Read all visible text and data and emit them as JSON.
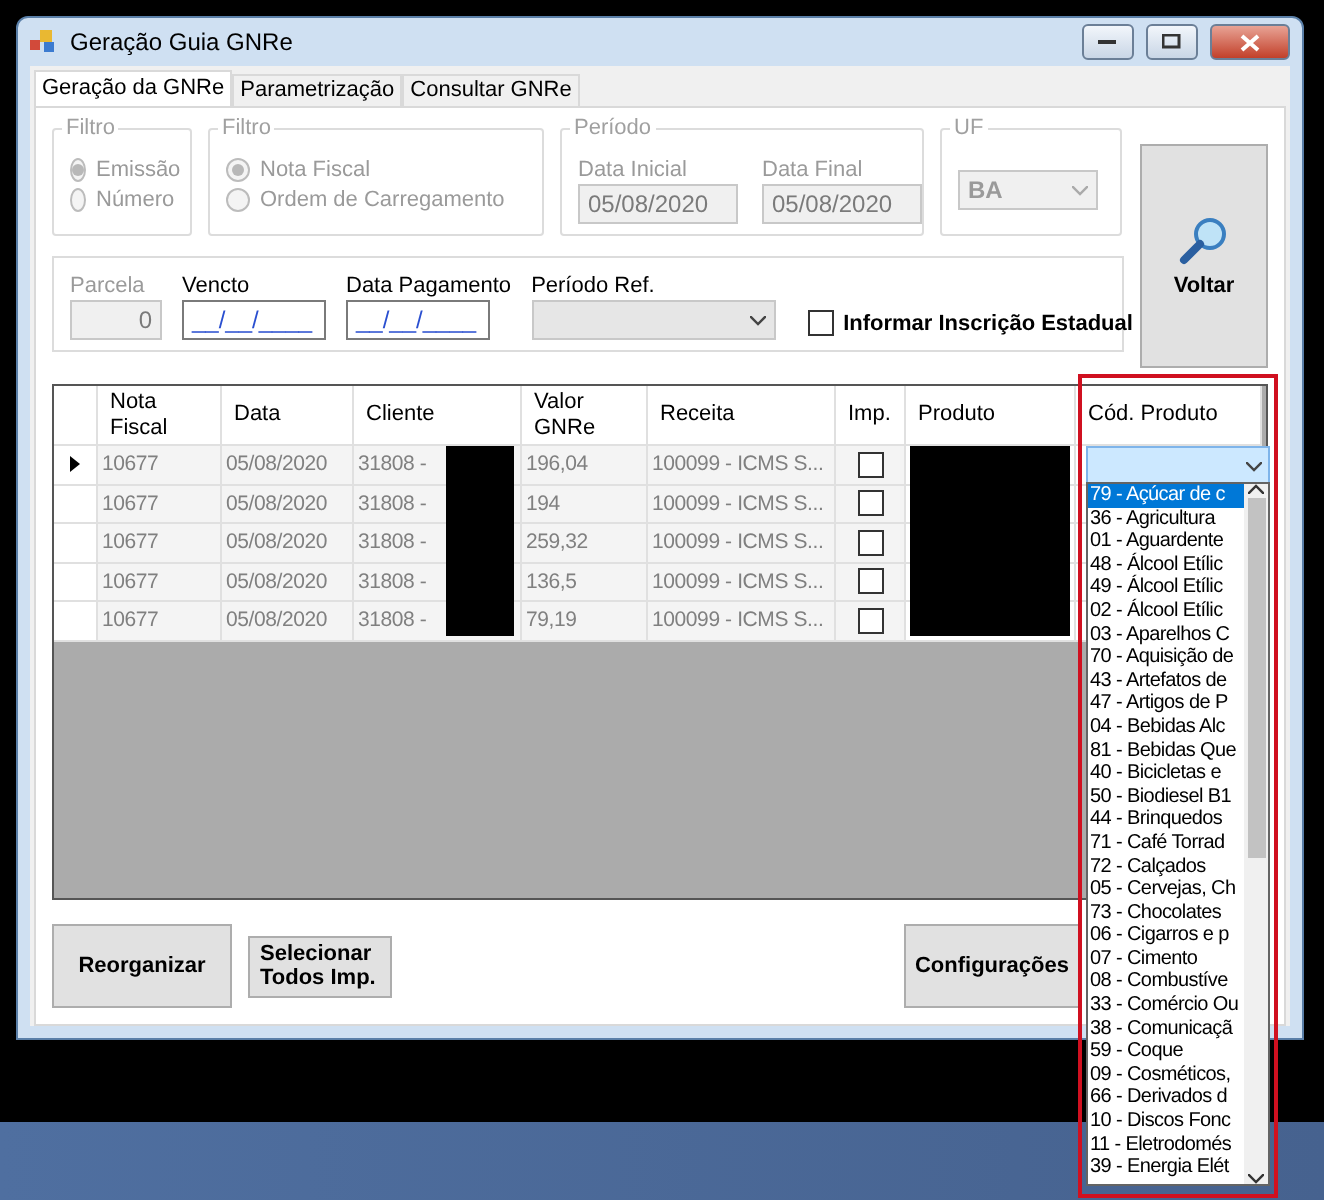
{
  "window": {
    "title": "Geração Guia GNRe"
  },
  "tabs": [
    {
      "label": "Geração da GNRe",
      "selected": true
    },
    {
      "label": "Parametrização",
      "selected": false
    },
    {
      "label": "Consultar GNRe",
      "selected": false
    }
  ],
  "filters": {
    "disabled": true,
    "groups": [
      {
        "kind": "radio",
        "title": "Filtro",
        "options": [
          {
            "label": "Emissão",
            "selected": true
          },
          {
            "label": "Número",
            "selected": false
          }
        ]
      },
      {
        "kind": "radio",
        "title": "Filtro",
        "options": [
          {
            "label": "Nota Fiscal",
            "selected": true
          },
          {
            "label": "Ordem de Carregamento",
            "selected": false
          }
        ]
      },
      {
        "kind": "dates",
        "title": "Período",
        "fields": [
          {
            "label": "Data Inicial",
            "value": "05/08/2020"
          },
          {
            "label": "Data Final",
            "value": "05/08/2020"
          }
        ]
      },
      {
        "kind": "select",
        "title": "UF",
        "value": "BA"
      }
    ]
  },
  "voltar_button": {
    "label": "Voltar"
  },
  "params": {
    "parcela": {
      "label": "Parcela",
      "value": "0",
      "disabled": true
    },
    "vencto": {
      "label": "Vencto",
      "value": "__/__/____"
    },
    "data_pagamento": {
      "label": "Data Pagamento",
      "value": "__/__/____"
    },
    "periodo_ref": {
      "label": "Período Ref."
    },
    "inscricao": {
      "label": "Informar Inscrição Estadual",
      "checked": false
    }
  },
  "grid": {
    "columns": [
      "Nota Fiscal",
      "Data",
      "Cliente",
      "Valor GNRe",
      "Receita",
      "Imp.",
      "Produto",
      "Cód. Produto"
    ],
    "rows": [
      {
        "current": true,
        "nota": "10677",
        "data": "05/08/2020",
        "cliente": "31808 -",
        "valor": "196,04",
        "receita": "100099 - ICMS S...",
        "imp": false
      },
      {
        "current": false,
        "nota": "10677",
        "data": "05/08/2020",
        "cliente": "31808 -",
        "valor": "194",
        "receita": "100099 - ICMS S...",
        "imp": false
      },
      {
        "current": false,
        "nota": "10677",
        "data": "05/08/2020",
        "cliente": "31808 -",
        "valor": "259,32",
        "receita": "100099 - ICMS S...",
        "imp": false
      },
      {
        "current": false,
        "nota": "10677",
        "data": "05/08/2020",
        "cliente": "31808 -",
        "valor": "136,5",
        "receita": "100099 - ICMS S...",
        "imp": false
      },
      {
        "current": false,
        "nota": "10677",
        "data": "05/08/2020",
        "cliente": "31808 -",
        "valor": "79,19",
        "receita": "100099 - ICMS S...",
        "imp": false
      }
    ]
  },
  "cod_produto_list": [
    {
      "label": "79 - Açúcar de c",
      "selected": true
    },
    {
      "label": "36 - Agricultura",
      "selected": false
    },
    {
      "label": "01 - Aguardente",
      "selected": false
    },
    {
      "label": "48 - Álcool Etílic",
      "selected": false
    },
    {
      "label": "49 - Álcool Etílic",
      "selected": false
    },
    {
      "label": "02 - Álcool Etílic",
      "selected": false
    },
    {
      "label": "03 - Aparelhos C",
      "selected": false
    },
    {
      "label": "70 - Aquisição de",
      "selected": false
    },
    {
      "label": "43 - Artefatos de",
      "selected": false
    },
    {
      "label": "47 - Artigos de P",
      "selected": false
    },
    {
      "label": "04 - Bebidas Alc",
      "selected": false
    },
    {
      "label": "81 - Bebidas Que",
      "selected": false
    },
    {
      "label": "40 - Bicicletas e",
      "selected": false
    },
    {
      "label": "50 - Biodiesel B1",
      "selected": false
    },
    {
      "label": "44 - Brinquedos",
      "selected": false
    },
    {
      "label": "71 - Café Torrad",
      "selected": false
    },
    {
      "label": "72 - Calçados",
      "selected": false
    },
    {
      "label": "05 - Cervejas, Ch",
      "selected": false
    },
    {
      "label": "73 - Chocolates",
      "selected": false
    },
    {
      "label": "06 - Cigarros e p",
      "selected": false
    },
    {
      "label": "07 - Cimento",
      "selected": false
    },
    {
      "label": "08 - Combustíve",
      "selected": false
    },
    {
      "label": "33 - Comércio Ou",
      "selected": false
    },
    {
      "label": "38 - Comunicaçã",
      "selected": false
    },
    {
      "label": "59 - Coque",
      "selected": false
    },
    {
      "label": "09 - Cosméticos,",
      "selected": false
    },
    {
      "label": "66 - Derivados d",
      "selected": false
    },
    {
      "label": "10 - Discos Fonc",
      "selected": false
    },
    {
      "label": "11 - Eletrodomés",
      "selected": false
    },
    {
      "label": "39 - Energia Elét",
      "selected": false
    }
  ],
  "bottom_buttons": [
    {
      "kind": "large",
      "label": "Reorganizar"
    },
    {
      "kind": "small",
      "label": "Selecionar Todos Imp."
    },
    {
      "kind": "right",
      "label": "Configurações"
    }
  ]
}
